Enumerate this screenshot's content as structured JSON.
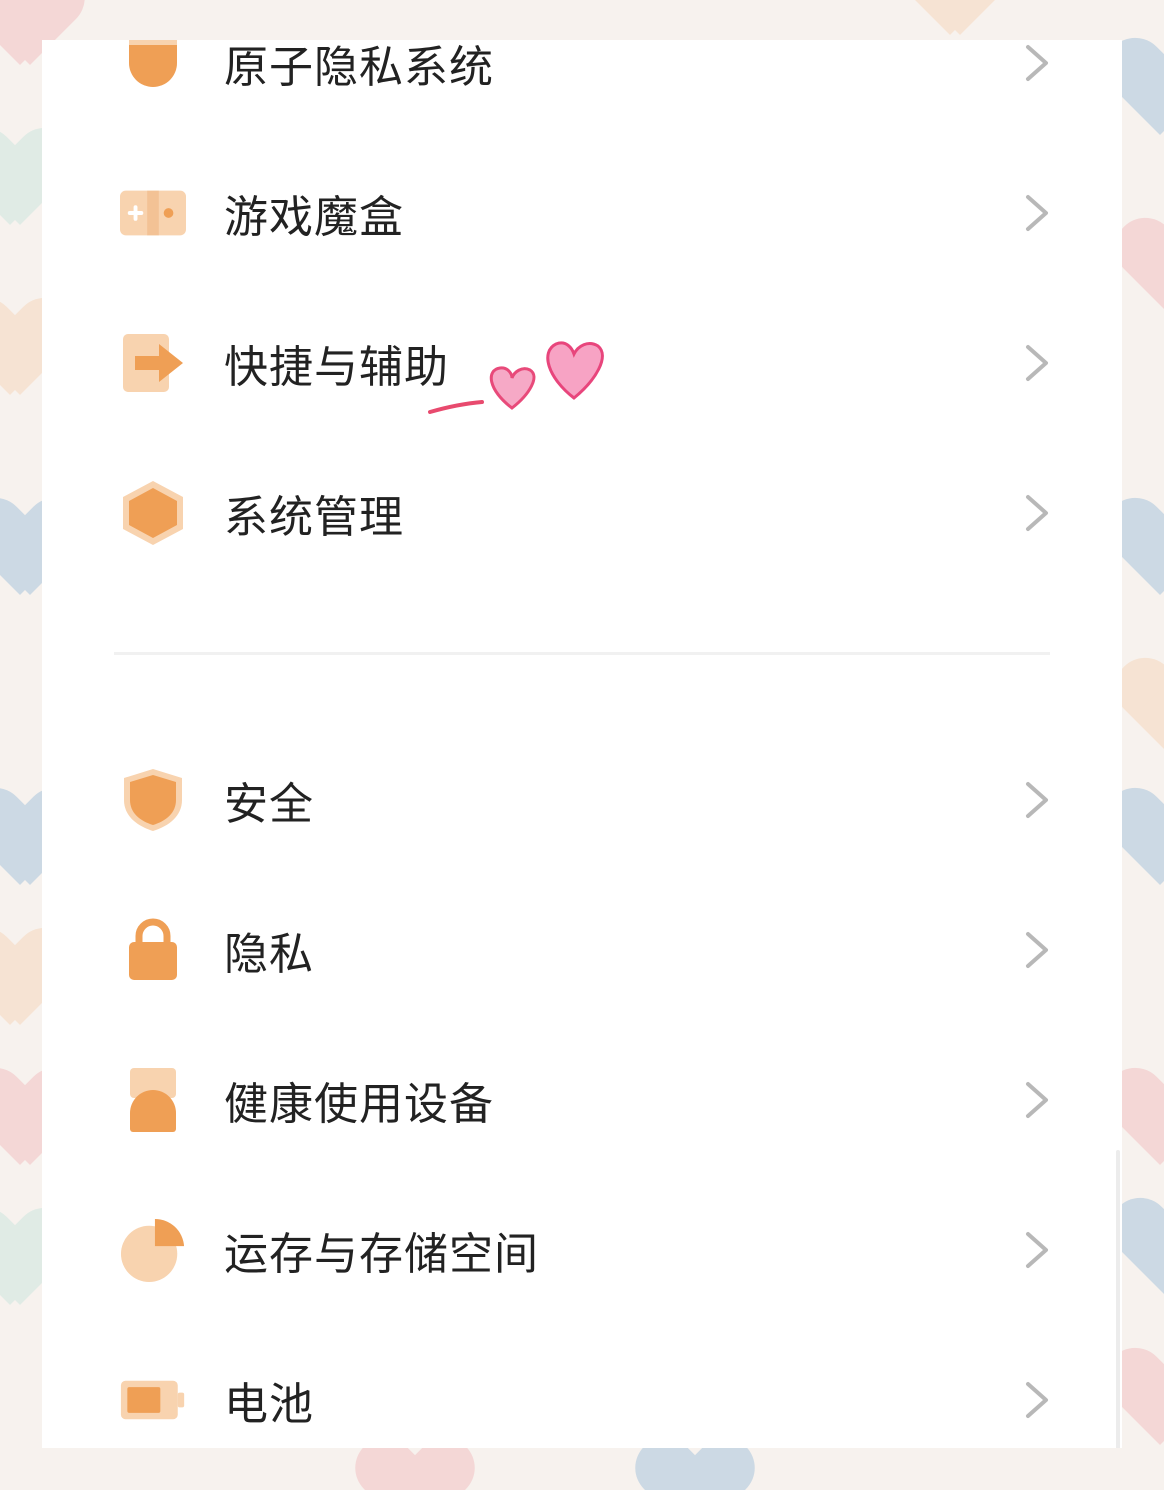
{
  "settings": {
    "items": [
      {
        "label": "原子隐私系统",
        "icon": "atomic-privacy-icon"
      },
      {
        "label": "游戏魔盒",
        "icon": "game-box-icon"
      },
      {
        "label": "快捷与辅助",
        "icon": "shortcut-assist-icon"
      },
      {
        "label": "系统管理",
        "icon": "system-management-icon"
      },
      {
        "label": "安全",
        "icon": "shield-icon"
      },
      {
        "label": "隐私",
        "icon": "lock-icon"
      },
      {
        "label": "健康使用设备",
        "icon": "digital-wellbeing-icon"
      },
      {
        "label": "运存与存储空间",
        "icon": "pie-storage-icon"
      },
      {
        "label": "电池",
        "icon": "battery-icon"
      }
    ]
  },
  "colors": {
    "accent": "#ef9f55",
    "accent_light": "#f8d3af",
    "text": "#222222",
    "chevron": "#b8b8b8",
    "doodle_pink": "#f06a9c"
  }
}
